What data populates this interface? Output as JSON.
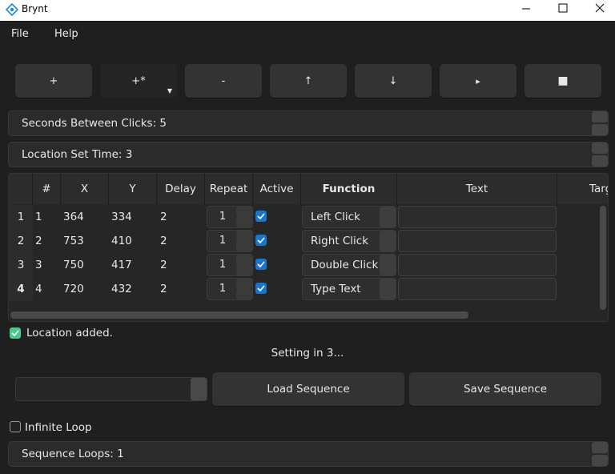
{
  "window": {
    "title": "Brynt"
  },
  "menu": {
    "file": "File",
    "help": "Help"
  },
  "toolbar": {
    "add": "+",
    "add_multi": "+*",
    "remove": "-",
    "move_up": "↑",
    "move_down": "↓",
    "play": "▸",
    "stop": "■"
  },
  "fields": {
    "seconds_between_clicks": "Seconds Between Clicks: 5",
    "location_set_time": "Location Set Time: 3"
  },
  "table": {
    "headers": [
      "#",
      "X",
      "Y",
      "Delay",
      "Repeat",
      "Active",
      "Function",
      "Text",
      "TargetI"
    ],
    "rows": [
      {
        "rownum": "1",
        "id": "1",
        "x": "364",
        "y": "334",
        "delay": "2",
        "repeat": "1",
        "active": true,
        "function": "Left Click",
        "text": ""
      },
      {
        "rownum": "2",
        "id": "2",
        "x": "753",
        "y": "410",
        "delay": "2",
        "repeat": "1",
        "active": true,
        "function": "Right Click",
        "text": ""
      },
      {
        "rownum": "3",
        "id": "3",
        "x": "750",
        "y": "417",
        "delay": "2",
        "repeat": "1",
        "active": true,
        "function": "Double Click",
        "text": ""
      },
      {
        "rownum": "4",
        "id": "4",
        "x": "720",
        "y": "432",
        "delay": "2",
        "repeat": "1",
        "active": true,
        "function": "Type Text",
        "text": ""
      }
    ]
  },
  "status": {
    "message": "Location added.",
    "setting": "Setting in 3..."
  },
  "buttons": {
    "load": "Load Sequence",
    "save": "Save Sequence"
  },
  "loop": {
    "infinite_label": "Infinite Loop",
    "sequence_loops": "Sequence Loops: 1"
  },
  "colors": {
    "accent": "#1876d1",
    "status_green": "#4ec78a",
    "background": "#1f1f1f"
  }
}
